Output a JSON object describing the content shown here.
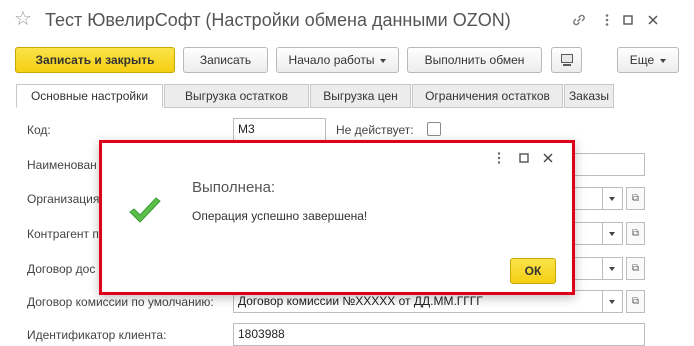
{
  "window": {
    "title": "Тест ЮвелирСофт (Настройки обмена данными OZON)",
    "icons": [
      "star-icon",
      "link-icon",
      "more-icon",
      "maximize-icon",
      "close-icon"
    ]
  },
  "toolbar": {
    "save_close": "Записать и закрыть",
    "save": "Записать",
    "start": "Начало работы",
    "exchange": "Выполнить обмен",
    "more": "Еще"
  },
  "tabs": [
    "Основные настройки",
    "Выгрузка остатков",
    "Выгрузка цен",
    "Ограничения остатков",
    "Заказы"
  ],
  "form": {
    "code_label": "Код:",
    "code_value": "М3",
    "inactive_label": "Не действует:",
    "name_label": "Наименован",
    "org_label": "Организация",
    "contractor_label": "Контрагент п",
    "contract_label": "Договор дос",
    "commission_label": "Договор комиссии по умолчанию:",
    "commission_value": "Договор комиссии №XXXXX от ДД.ММ.ГГГГ",
    "client_id_label": "Идентификатор клиента:",
    "client_id_value": "1803988"
  },
  "dialog": {
    "title": "Выполнена:",
    "message": "Операция успешно завершена!",
    "ok": "ОК",
    "accent_color": "#e0001b"
  },
  "colors": {
    "primary_button": "#f4cf12",
    "success_check": "#3aa63f"
  }
}
